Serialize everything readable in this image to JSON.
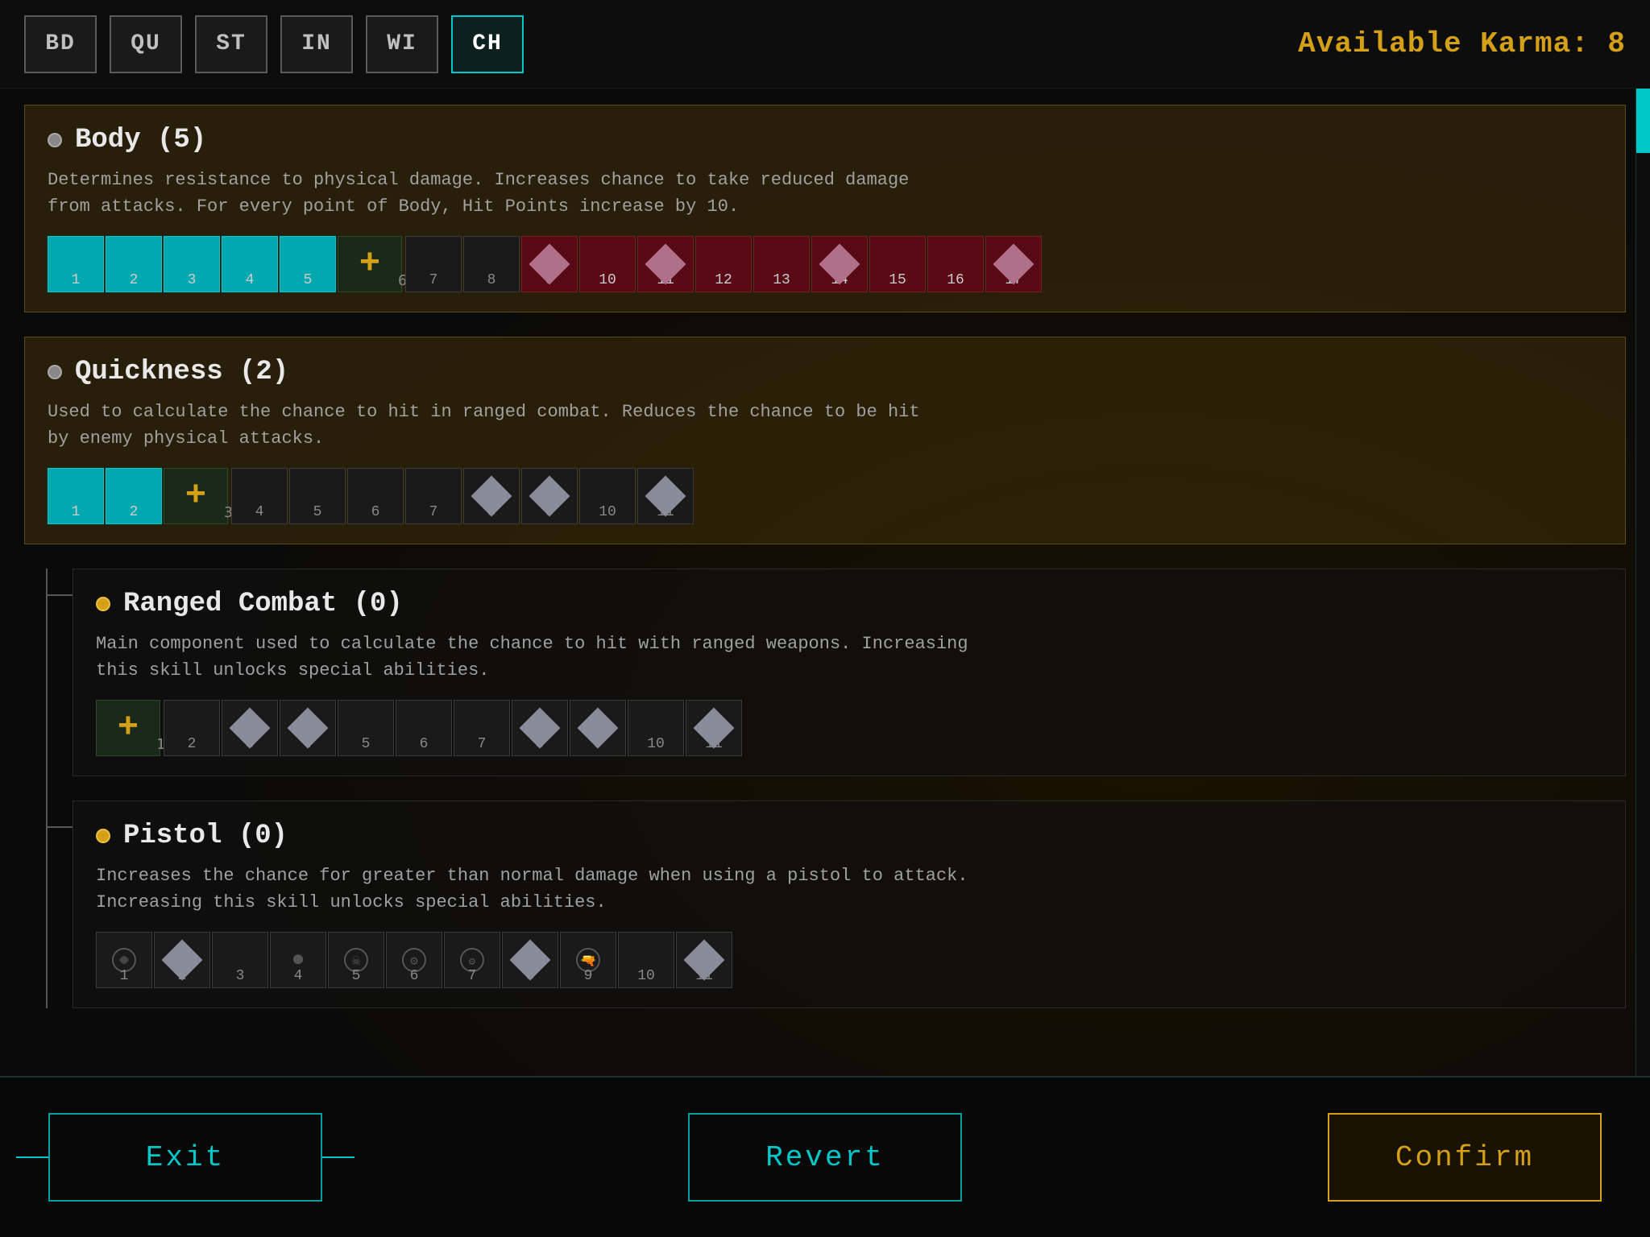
{
  "topBar": {
    "tabs": [
      {
        "id": "BD",
        "label": "BD",
        "active": false
      },
      {
        "id": "QU",
        "label": "QU",
        "active": false
      },
      {
        "id": "ST",
        "label": "ST",
        "active": false
      },
      {
        "id": "IN",
        "label": "IN",
        "active": false
      },
      {
        "id": "WI",
        "label": "WI",
        "active": false
      },
      {
        "id": "CH",
        "label": "CH",
        "active": true
      }
    ],
    "karma_label": "Available Karma: 8"
  },
  "stats": [
    {
      "id": "body",
      "title": "Body (5)",
      "description": "Determines resistance to physical damage. Increases chance to take reduced damage from attacks. For every point of Body, Hit Points increase by 10.",
      "highlighted": true,
      "currentValue": 5,
      "maxValue": 17,
      "addNextLabel": "6",
      "filledCount": 5,
      "darkFilledStart": 9,
      "diamonds": [
        9,
        11,
        14,
        17
      ],
      "sub_skills": []
    },
    {
      "id": "quickness",
      "title": "Quickness (2)",
      "description": "Used to calculate the chance to hit in ranged combat. Reduces the chance to be hit by enemy physical attacks.",
      "highlighted": true,
      "currentValue": 2,
      "maxValue": 11,
      "addNextLabel": "3",
      "filledCount": 2,
      "darkFilledStart": 99,
      "diamonds": [
        8,
        9,
        11
      ],
      "sub_skills": [
        {
          "id": "ranged_combat",
          "title": "Ranged Combat (0)",
          "description": "Main component used to calculate the chance to hit with ranged weapons. Increasing this skill unlocks special abilities.",
          "currentValue": 0,
          "maxValue": 11,
          "addNextLabel": "1",
          "filledCount": 0,
          "diamonds": [
            3,
            4,
            8,
            9,
            11
          ]
        },
        {
          "id": "pistol",
          "title": "Pistol (0)",
          "description": "Increases the chance for greater than normal damage when using a pistol to attack. Increasing this skill unlocks special abilities.",
          "currentValue": 0,
          "maxValue": 11,
          "addNextLabel": "1",
          "filledCount": 0,
          "diamonds": [
            2,
            8
          ]
        }
      ]
    }
  ],
  "buttons": {
    "exit": "Exit",
    "revert": "Revert",
    "confirm": "Confirm"
  }
}
